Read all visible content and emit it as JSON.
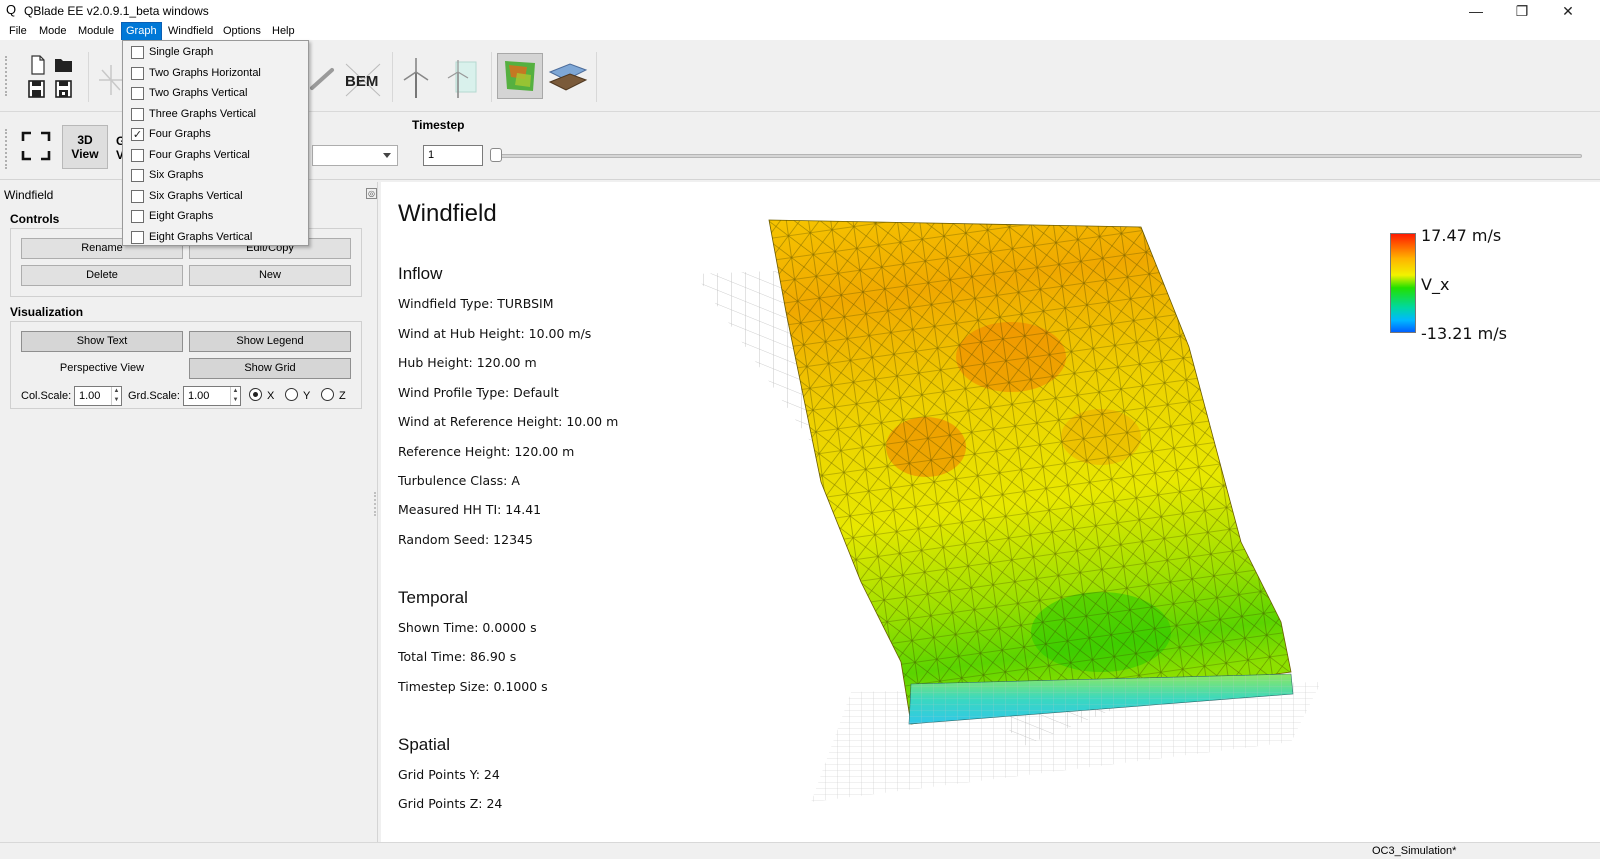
{
  "window": {
    "title": "QBlade EE v2.0.9.1_beta windows",
    "app_icon": "Q",
    "minimize": "—",
    "restore": "❐",
    "close": "✕"
  },
  "menubar": {
    "items": [
      "File",
      "Mode",
      "Module",
      "Graph",
      "Windfield",
      "Options",
      "Help"
    ],
    "active": "Graph"
  },
  "graph_menu": {
    "items": [
      {
        "label": "Single Graph",
        "checked": false
      },
      {
        "label": "Two Graphs Horizontal",
        "checked": false
      },
      {
        "label": "Two Graphs Vertical",
        "checked": false
      },
      {
        "label": "Three Graphs Vertical",
        "checked": false
      },
      {
        "label": "Four Graphs",
        "checked": true
      },
      {
        "label": "Four Graphs Vertical",
        "checked": false
      },
      {
        "label": "Six Graphs",
        "checked": false
      },
      {
        "label": "Six Graphs Vertical",
        "checked": false
      },
      {
        "label": "Eight Graphs",
        "checked": false
      },
      {
        "label": "Eight Graphs Vertical",
        "checked": false
      }
    ],
    "check_mark": "✓"
  },
  "toolbar": {
    "bem_label": "BEM",
    "icons": [
      "new-file-icon",
      "open-folder-icon",
      "save-icon",
      "save-as-icon",
      "blade-icon",
      "bem-icon",
      "turbine-icon",
      "turbine-field-icon",
      "windfield-3d-icon",
      "windfield-surface-icon"
    ]
  },
  "toolbar2": {
    "view3d_line1": "3D",
    "view3d_line2": "View",
    "obscured_button_letters": [
      "G",
      "V"
    ],
    "timestep_label": "Timestep",
    "timestep_value": "1",
    "slider_value": 0
  },
  "dock": {
    "title": "Windfield",
    "float_icon": "◎",
    "controls_title": "Controls",
    "rename": "Rename",
    "edit_copy": "Edit/Copy",
    "delete": "Delete",
    "new": "New",
    "visualization_title": "Visualization",
    "show_text": "Show Text",
    "show_legend": "Show Legend",
    "perspective_view": "Perspective View",
    "show_grid": "Show Grid",
    "col_scale_label": "Col.Scale:",
    "col_scale_value": "1.00",
    "grd_scale_label": "Grd.Scale:",
    "grd_scale_value": "1.00",
    "axis_options": [
      "X",
      "Y",
      "Z"
    ],
    "axis_selected": "X"
  },
  "view": {
    "heading": "Windfield",
    "inflow_heading": "Inflow",
    "inflow_lines": [
      "Windfield Type: TURBSIM",
      "Wind at Hub Height: 10.00 m/s",
      "Hub Height: 120.00 m",
      "Wind Profile Type: Default",
      "Wind at Reference Height: 10.00 m",
      "Reference Height: 120.00 m",
      "Turbulence Class: A",
      "Measured HH TI: 14.41",
      "Random Seed: 12345"
    ],
    "temporal_heading": "Temporal",
    "temporal_lines": [
      "Shown Time: 0.0000 s",
      "Total Time: 86.90 s",
      "Timestep Size: 0.1000 s"
    ],
    "spatial_heading": "Spatial",
    "spatial_lines": [
      "Grid Points Y: 24",
      "Grid Points Z: 24"
    ]
  },
  "legend": {
    "max_label": "17.47 m/s",
    "variable_label": "V_x",
    "min_label": "-13.21 m/s"
  },
  "statusbar": {
    "project": "OC3_Simulation*"
  },
  "colors": {
    "menu_highlight": "#0078d7",
    "surface_high": "#f08a00",
    "surface_mid": "#f0e000",
    "surface_low": "#22dd00",
    "surface_base": "#30d8d0"
  }
}
